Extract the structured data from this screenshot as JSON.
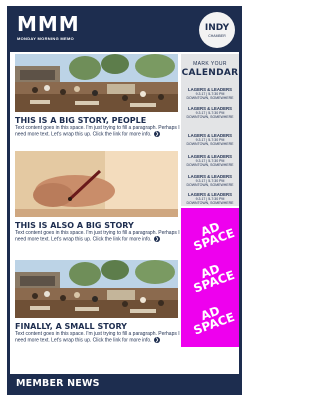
{
  "header": {
    "logo": "MMM",
    "logo_subtitle": "MONDAY MORNING MEMO",
    "badge": {
      "top": "INDY",
      "bottom": "CHAMBER"
    }
  },
  "stories": [
    {
      "title": "THIS IS A BIG STORY, PEOPLE",
      "body": "Text content goes in this space. I'm just trying to fill a paragraph. Perhaps I need more text. Let's wrap this up. Click the link for more info.",
      "image": "outdoor-dining-patio-photo"
    },
    {
      "title": "THIS IS ALSO A BIG STORY",
      "body": "Text content goes in this space. I'm just trying to fill a paragraph. Perhaps I need more text. Let's wrap this up. Click the link for more info.",
      "image": "hand-writing-with-pen-photo"
    },
    {
      "title": "FINALLY, A SMALL STORY",
      "body": "Text content goes in this space. I'm just trying to fill a paragraph. Perhaps I need more text. Let's wrap this up. Click the link for more info.",
      "image": "outdoor-dining-patio-photo"
    }
  ],
  "calendar": {
    "heading_top": "MARK YOUR",
    "heading": "CALENDAR",
    "events": [
      {
        "name": "LAGERS & LEADERS",
        "line1": "9.3.17 | 5-7:30 PM",
        "line2": "DOWNTOWN, SOMEWHERE"
      },
      {
        "name": "LAGERS & LEADERS",
        "line1": "9.3.17 | 5-7:30 PM",
        "line2": "DOWNTOWN, SOMEWHERE"
      },
      {
        "name": "LAGERS & LEADERS",
        "line1": "9.3.17 | 5-7:30 PM",
        "line2": "DOWNTOWN, SOMEWHERE"
      },
      {
        "name": "LAGERS & LEADERS",
        "line1": "9.3.17 | 5-7:30 PM",
        "line2": "DOWNTOWN, SOMEWHERE"
      },
      {
        "name": "LAGERS & LEADERS",
        "line1": "9.3.17 | 5-7:30 PM",
        "line2": "DOWNTOWN, SOMEWHERE"
      },
      {
        "name": "LAGERS & LEADERS",
        "line1": "9.3.17 | 5-7:30 PM",
        "line2": "DOWNTOWN, SOMEWHERE"
      }
    ]
  },
  "ad": {
    "lines": [
      "AD SPACE",
      "AD SPACE",
      "AD SPACE"
    ],
    "color": "#ee00ee"
  },
  "footer": {
    "title": "MEMBER NEWS"
  },
  "colors": {
    "navy": "#1d2d4f",
    "sidebar_bg": "#e3e4e6",
    "ad_magenta": "#ee00ee"
  },
  "icons": {
    "more_link": "arrow-circle-icon"
  }
}
